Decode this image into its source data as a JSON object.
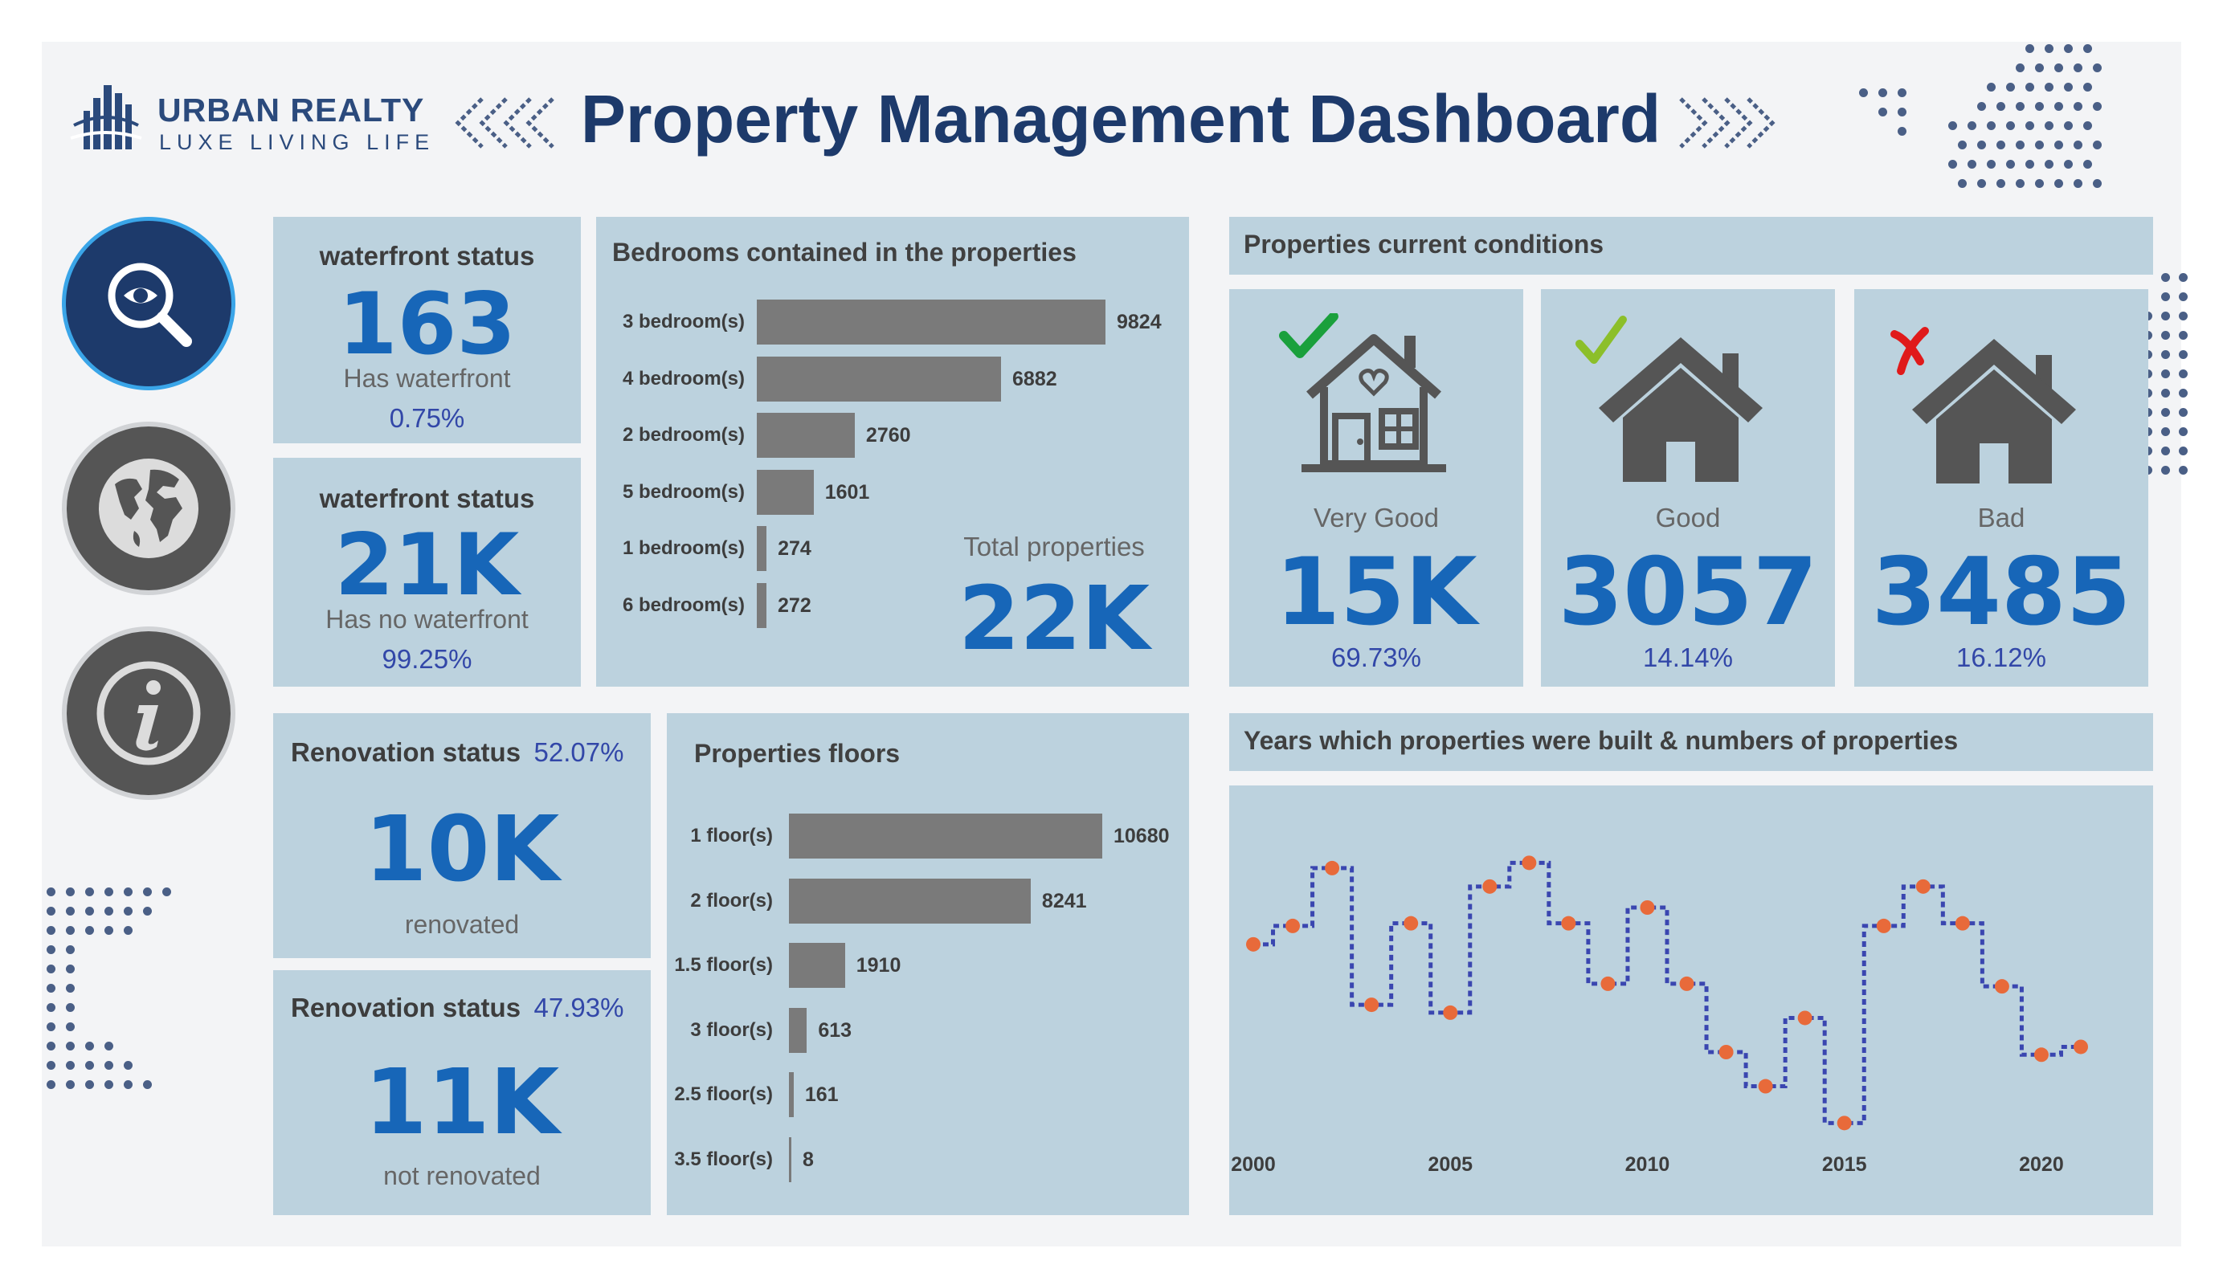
{
  "brand": {
    "name": "URBAN REALTY",
    "tagline": "LUXE LIVING LIFE"
  },
  "header": {
    "title": "Property Management Dashboard"
  },
  "colors": {
    "navy": "#1d3a6b",
    "panel": "#bcd2de",
    "kpi_blue": "#1766b8",
    "pct_blue": "#3247a8",
    "bar_gray": "#7a7a7a",
    "line_dash": "#3a46b0",
    "point_orange": "#e86a3a",
    "check_green": "#1aa03c",
    "check_lime": "#8cbf2a",
    "cross_red": "#e01a1a"
  },
  "nav": {
    "items": [
      {
        "name": "search-eye-icon",
        "active": true
      },
      {
        "name": "globe-icon",
        "active": false
      },
      {
        "name": "info-icon",
        "active": false
      }
    ]
  },
  "waterfront": {
    "has": {
      "title": "waterfront status",
      "value": "163",
      "label": "Has waterfront",
      "pct": "0.75%"
    },
    "none": {
      "title": "waterfront status",
      "value": "21K",
      "label": "Has no waterfront",
      "pct": "99.25%"
    }
  },
  "renovation": {
    "done": {
      "title": "Renovation status",
      "pct": "52.07%",
      "value": "10K",
      "label": "renovated"
    },
    "not": {
      "title": "Renovation status",
      "pct": "47.93%",
      "value": "11K",
      "label": "not renovated"
    }
  },
  "bedrooms": {
    "title": "Bedrooms contained in the properties",
    "total_label": "Total properties",
    "total_value": "22K",
    "chart_data": {
      "type": "bar",
      "orientation": "horizontal",
      "categories": [
        "3 bedroom(s)",
        "4 bedroom(s)",
        "2 bedroom(s)",
        "5 bedroom(s)",
        "1 bedroom(s)",
        "6 bedroom(s)"
      ],
      "values": [
        9824,
        6882,
        2760,
        1601,
        274,
        272
      ],
      "value_labels": [
        "9824",
        "6882",
        "2760",
        "1601",
        "274",
        "272"
      ]
    }
  },
  "floors": {
    "title": "Properties floors",
    "chart_data": {
      "type": "bar",
      "orientation": "horizontal",
      "categories": [
        "1 floor(s)",
        "2 floor(s)",
        "1.5 floor(s)",
        "3 floor(s)",
        "2.5 floor(s)",
        "3.5 floor(s)"
      ],
      "values": [
        10680,
        8241,
        1910,
        613,
        161,
        8
      ],
      "value_labels": [
        "10680",
        "8241",
        "1910",
        "613",
        "161",
        "8"
      ]
    }
  },
  "conditions": {
    "title": "Properties current conditions",
    "items": [
      {
        "label": "Very Good",
        "value": "15K",
        "pct": "69.73%",
        "mark": "check-green"
      },
      {
        "label": "Good",
        "value": "3057",
        "pct": "14.14%",
        "mark": "check-lime"
      },
      {
        "label": "Bad",
        "value": "3485",
        "pct": "16.12%",
        "mark": "cross-red"
      }
    ]
  },
  "years": {
    "title": "Years which properties were built & numbers of properties",
    "chart_data": {
      "type": "line",
      "step": true,
      "x": [
        2000,
        2001,
        2002,
        2003,
        2004,
        2005,
        2006,
        2007,
        2008,
        2009,
        2010,
        2011,
        2012,
        2013,
        2014,
        2015,
        2016,
        2017,
        2018,
        2019,
        2020,
        2021
      ],
      "y": [
        370,
        405,
        515,
        255,
        410,
        240,
        480,
        525,
        410,
        295,
        440,
        295,
        165,
        100,
        230,
        30,
        405,
        480,
        410,
        290,
        160,
        175
      ],
      "xticks": [
        "2000",
        "2005",
        "2010",
        "2015",
        "2020"
      ],
      "grid": false,
      "yaxis_visible": false
    }
  }
}
